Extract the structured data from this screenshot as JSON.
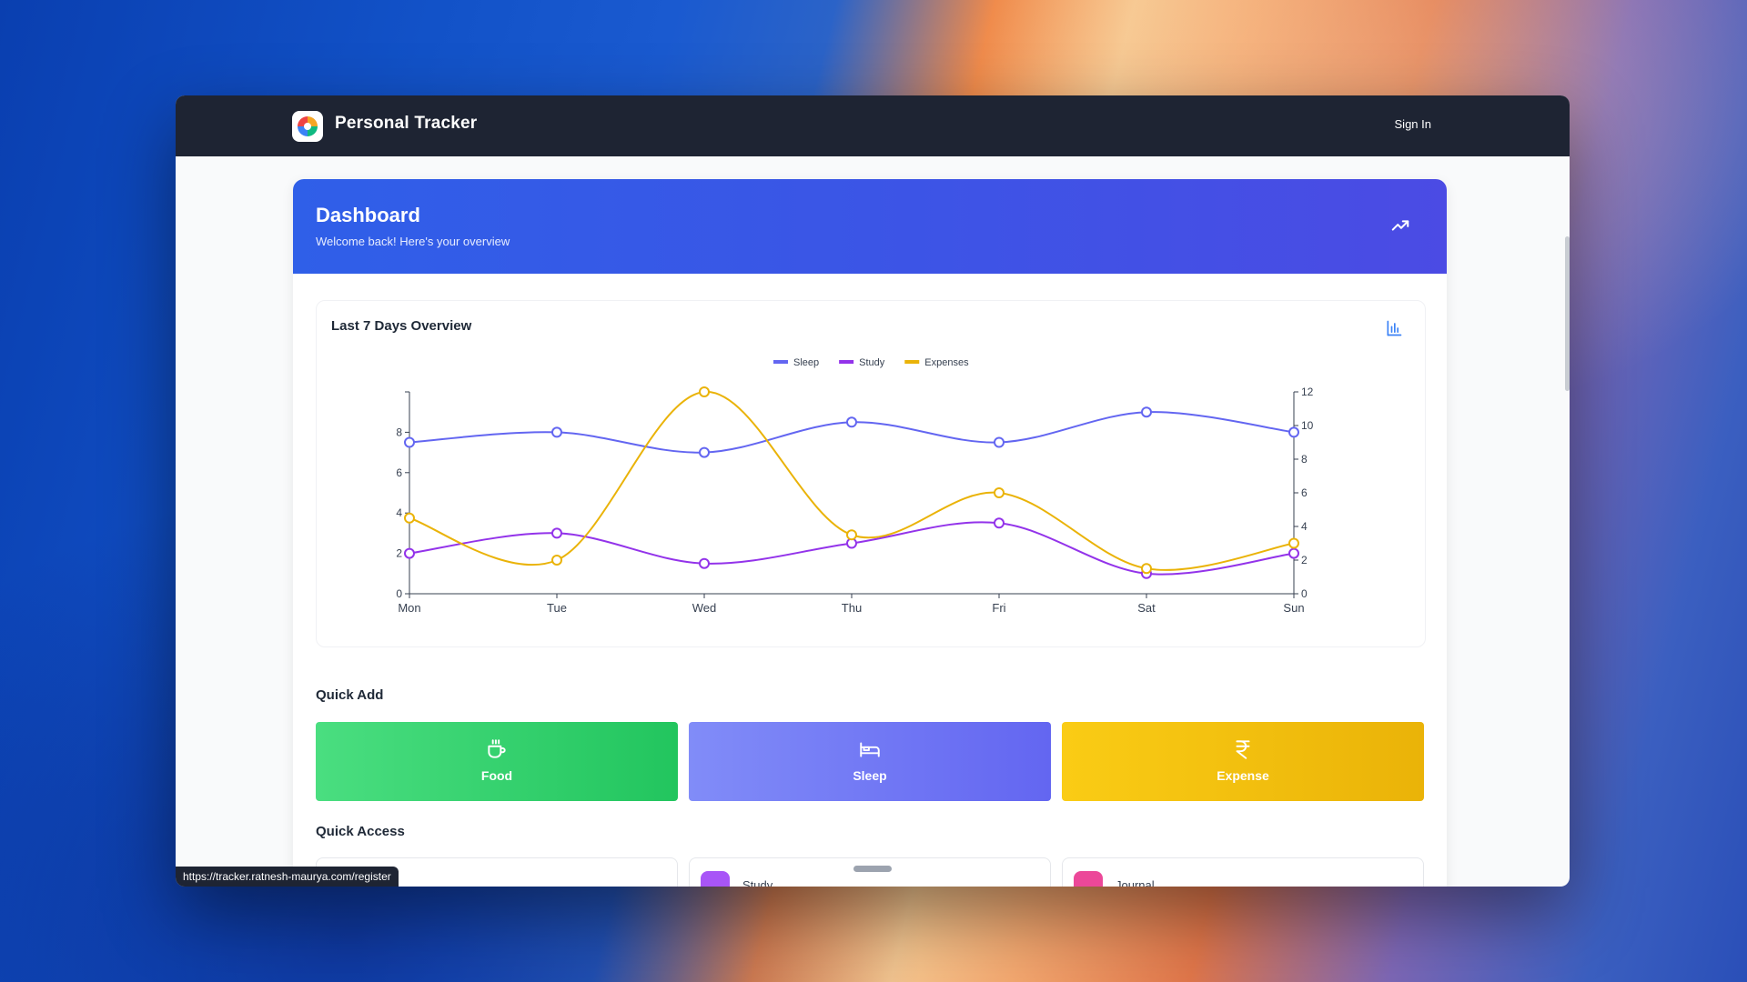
{
  "navbar": {
    "app_title": "Personal Tracker",
    "sign_in": "Sign In"
  },
  "hero": {
    "title": "Dashboard",
    "subtitle": "Welcome back! Here's your overview"
  },
  "chart_card": {
    "title": "Last 7 Days Overview"
  },
  "chart_data": {
    "type": "line",
    "categories": [
      "Mon",
      "Tue",
      "Wed",
      "Thu",
      "Fri",
      "Sat",
      "Sun"
    ],
    "series": [
      {
        "name": "Sleep",
        "axis": "left",
        "color": "#6366f1",
        "values": [
          7.5,
          8,
          7,
          8.5,
          7.5,
          9,
          8
        ]
      },
      {
        "name": "Study",
        "axis": "left",
        "color": "#9333ea",
        "values": [
          2,
          3,
          1.5,
          2.5,
          3.5,
          1,
          2
        ]
      },
      {
        "name": "Expenses",
        "axis": "right",
        "color": "#eab308",
        "values": [
          4.5,
          2,
          12,
          3.5,
          6,
          1.5,
          3
        ]
      }
    ],
    "left_axis": {
      "ylim": [
        0,
        10
      ],
      "ticks": [
        "0",
        "2",
        "4",
        "6",
        "8"
      ]
    },
    "right_axis": {
      "ylim": [
        0,
        12
      ],
      "ticks": [
        "0",
        "2",
        "4",
        "6",
        "8",
        "10",
        "12"
      ]
    },
    "legend_position": "top-center",
    "grid": false
  },
  "quick_add": {
    "heading": "Quick Add",
    "buttons": [
      {
        "label": "Food",
        "icon": "coffee-icon"
      },
      {
        "label": "Sleep",
        "icon": "bed-icon"
      },
      {
        "label": "Expense",
        "icon": "rupee-icon"
      }
    ]
  },
  "quick_access": {
    "heading": "Quick Access",
    "items": [
      {
        "label": "",
        "color": "#3b82f6"
      },
      {
        "label": "Study",
        "color": "#a855f7"
      },
      {
        "label": "Journal",
        "color": "#ec4899"
      }
    ]
  },
  "status_url": "https://tracker.ratnesh-maurya.com/register",
  "colors": {
    "navbar": "#1e2433",
    "hero_start": "#2f5fe8",
    "hero_end": "#4b4be4"
  }
}
